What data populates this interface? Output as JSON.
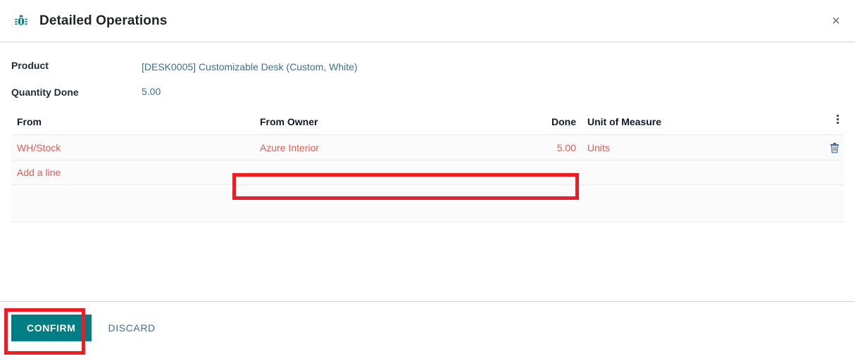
{
  "header": {
    "icon": "bug-icon",
    "title": "Detailed Operations",
    "close_label": "×"
  },
  "fields": [
    {
      "label": "Product",
      "value": "[DESK0005] Customizable Desk (Custom, White)"
    },
    {
      "label": "Quantity Done",
      "value": "5.00"
    }
  ],
  "table": {
    "columns": [
      {
        "key": "from",
        "label": "From",
        "align": "left"
      },
      {
        "key": "from_owner",
        "label": "From Owner",
        "align": "left"
      },
      {
        "key": "done",
        "label": "Done",
        "align": "right"
      },
      {
        "key": "uom",
        "label": "Unit of Measure",
        "align": "left"
      }
    ],
    "options_icon": "vertical-dots-icon",
    "rows": [
      {
        "from": "WH/Stock",
        "from_owner": "Azure Interior",
        "done": "5.00",
        "uom": "Units",
        "delete_icon": "trash-icon"
      }
    ],
    "add_line_label": "Add a line"
  },
  "footer": {
    "confirm_label": "CONFIRM",
    "discard_label": "DISCARD"
  },
  "annotations": [
    {
      "name": "owner-done-highlight",
      "color": "#ee1c25"
    },
    {
      "name": "confirm-highlight",
      "color": "#ee1c25"
    }
  ],
  "colors": {
    "accent_teal": "#017e84",
    "link_blue": "#3f6f93",
    "row_red": "#e05c54",
    "annotation_red": "#ee1c25",
    "divider": "#cfd2d6"
  }
}
